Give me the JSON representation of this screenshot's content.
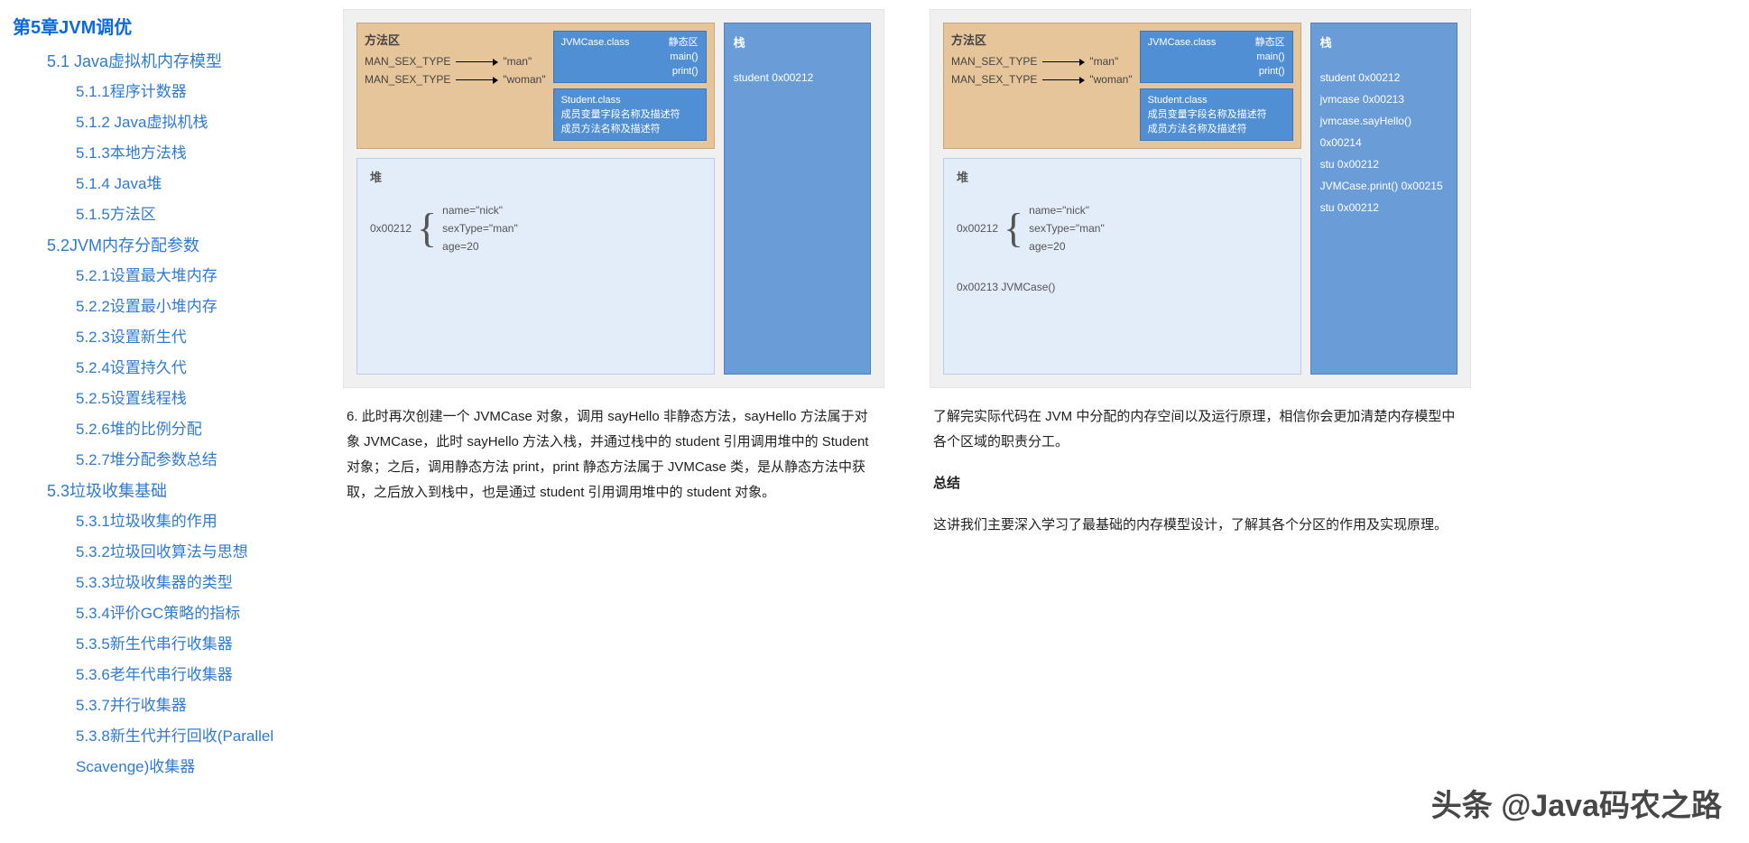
{
  "toc": {
    "chapter": "第5章JVM调优",
    "items": [
      {
        "lvl": 2,
        "t": "5.1 Java虚拟机内存模型"
      },
      {
        "lvl": 3,
        "t": "5.1.1程序计数器"
      },
      {
        "lvl": 3,
        "t": "5.1.2 Java虚拟机栈"
      },
      {
        "lvl": 3,
        "t": "5.1.3本地方法栈"
      },
      {
        "lvl": 3,
        "t": "5.1.4 Java堆"
      },
      {
        "lvl": 3,
        "t": "5.1.5方法区"
      },
      {
        "lvl": 2,
        "t": "5.2JVM内存分配参数"
      },
      {
        "lvl": 3,
        "t": "5.2.1设置最大堆内存"
      },
      {
        "lvl": 3,
        "t": "5.2.2设置最小堆内存"
      },
      {
        "lvl": 3,
        "t": "5.2.3设置新生代"
      },
      {
        "lvl": 3,
        "t": "5.2.4设置持久代"
      },
      {
        "lvl": 3,
        "t": "5.2.5设置线程栈"
      },
      {
        "lvl": 3,
        "t": "5.2.6堆的比例分配"
      },
      {
        "lvl": 3,
        "t": "5.2.7堆分配参数总结"
      },
      {
        "lvl": 2,
        "t": "5.3垃圾收集基础"
      },
      {
        "lvl": 3,
        "t": "5.3.1垃圾收集的作用"
      },
      {
        "lvl": 3,
        "t": "5.3.2垃圾回收算法与思想"
      },
      {
        "lvl": 3,
        "t": "5.3.3垃圾收集器的类型"
      },
      {
        "lvl": 3,
        "t": "5.3.4评价GC策略的指标"
      },
      {
        "lvl": 3,
        "t": "5.3.5新生代串行收集器"
      },
      {
        "lvl": 3,
        "t": "5.3.6老年代串行收集器"
      },
      {
        "lvl": 3,
        "t": "5.3.7并行收集器"
      },
      {
        "lvl": 3,
        "t": "5.3.8新生代并行回收(Parallel Scavenge)收集器"
      }
    ]
  },
  "diagram_common": {
    "method_area_title": "方法区",
    "heap_title": "堆",
    "stack_title": "栈",
    "map1_key": "MAN_SEX_TYPE",
    "map1_val": "\"man\"",
    "map2_key": "MAN_SEX_TYPE",
    "map2_val": "\"woman\"",
    "class1": {
      "name": "JVMCase.class",
      "group": "静态区",
      "m1": "main()",
      "m2": "print()"
    },
    "class2": {
      "name": "Student.class",
      "d1": "成员变量字段名称及描述符",
      "d2": "成员方法名称及描述符"
    },
    "heap_addr": "0x00212",
    "heap_fields": {
      "f1": "name=\"nick\"",
      "f2": "sexType=\"man\"",
      "f3": "age=20"
    }
  },
  "left": {
    "stack_items": [
      "student  0x00212"
    ],
    "para": "6. 此时再次创建一个 JVMCase 对象，调用 sayHello 非静态方法，sayHello 方法属于对象 JVMCase，此时 sayHello 方法入栈，并通过栈中的 student 引用调用堆中的 Student 对象；之后，调用静态方法 print，print 静态方法属于 JVMCase 类，是从静态方法中获取，之后放入到栈中，也是通过 student 引用调用堆中的 student 对象。"
  },
  "right": {
    "stack_items": [
      "student  0x00212",
      "jvmcase  0x00213",
      "jvmcase.sayHello() 0x00214",
      "stu  0x00212",
      "JVMCase.print()  0x00215",
      "stu  0x00212"
    ],
    "heap_extra": "0x00213  JVMCase()",
    "para1": "了解完实际代码在 JVM 中分配的内存空间以及运行原理，相信你会更加清楚内存模型中各个区域的职责分工。",
    "summary_h": "总结",
    "para2": "这讲我们主要深入学习了最基础的内存模型设计，了解其各个分区的作用及实现原理。"
  },
  "watermark": "头条 @Java码农之路"
}
